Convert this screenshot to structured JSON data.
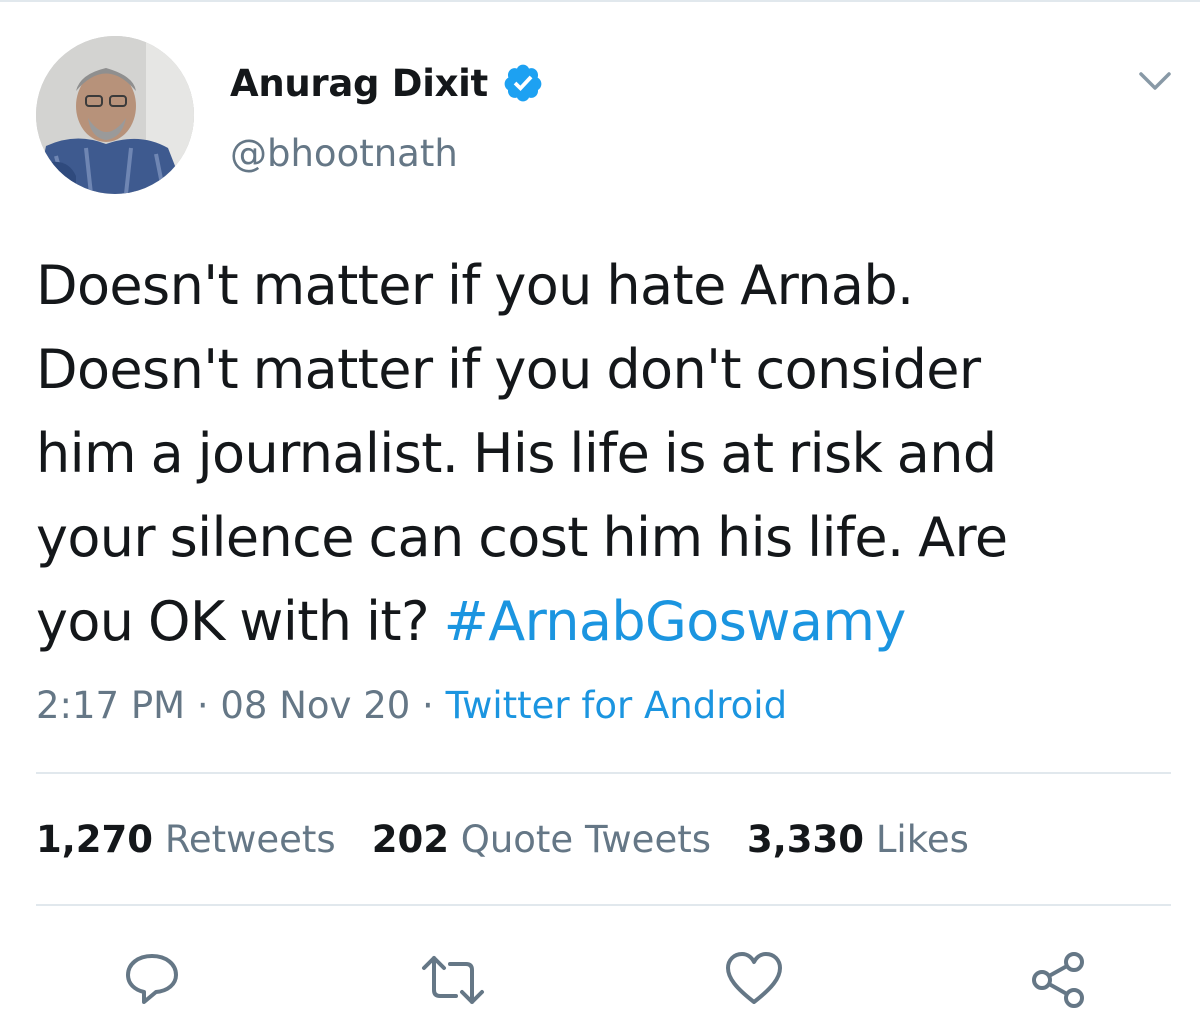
{
  "tweet": {
    "display_name": "Anurag Dixit",
    "handle": "@bhootnath",
    "verified": true,
    "text_lines": [
      "Doesn't matter if you hate Arnab.",
      "Doesn't matter if you don't consider",
      "him a journalist. His life is at risk and",
      "your silence can cost him his life. Are",
      "you OK with it? "
    ],
    "hashtag": "#ArnabGoswamy",
    "time": "2:17 PM",
    "date": "08 Nov 20",
    "separator": " · ",
    "source": "Twitter for Android"
  },
  "stats": {
    "retweets_count": "1,270",
    "retweets_label": "Retweets",
    "quotes_count": "202",
    "quotes_label": "Quote Tweets",
    "likes_count": "3,330",
    "likes_label": "Likes"
  },
  "icons": {
    "verified": "verified-badge-icon",
    "more": "chevron-down-icon",
    "reply": "reply-icon",
    "retweet": "retweet-icon",
    "like": "heart-icon",
    "share": "share-icon"
  },
  "colors": {
    "link": "#1b95e0",
    "secondary_text": "#657786",
    "primary_text": "#14171a",
    "divider": "#e1e8ed"
  }
}
